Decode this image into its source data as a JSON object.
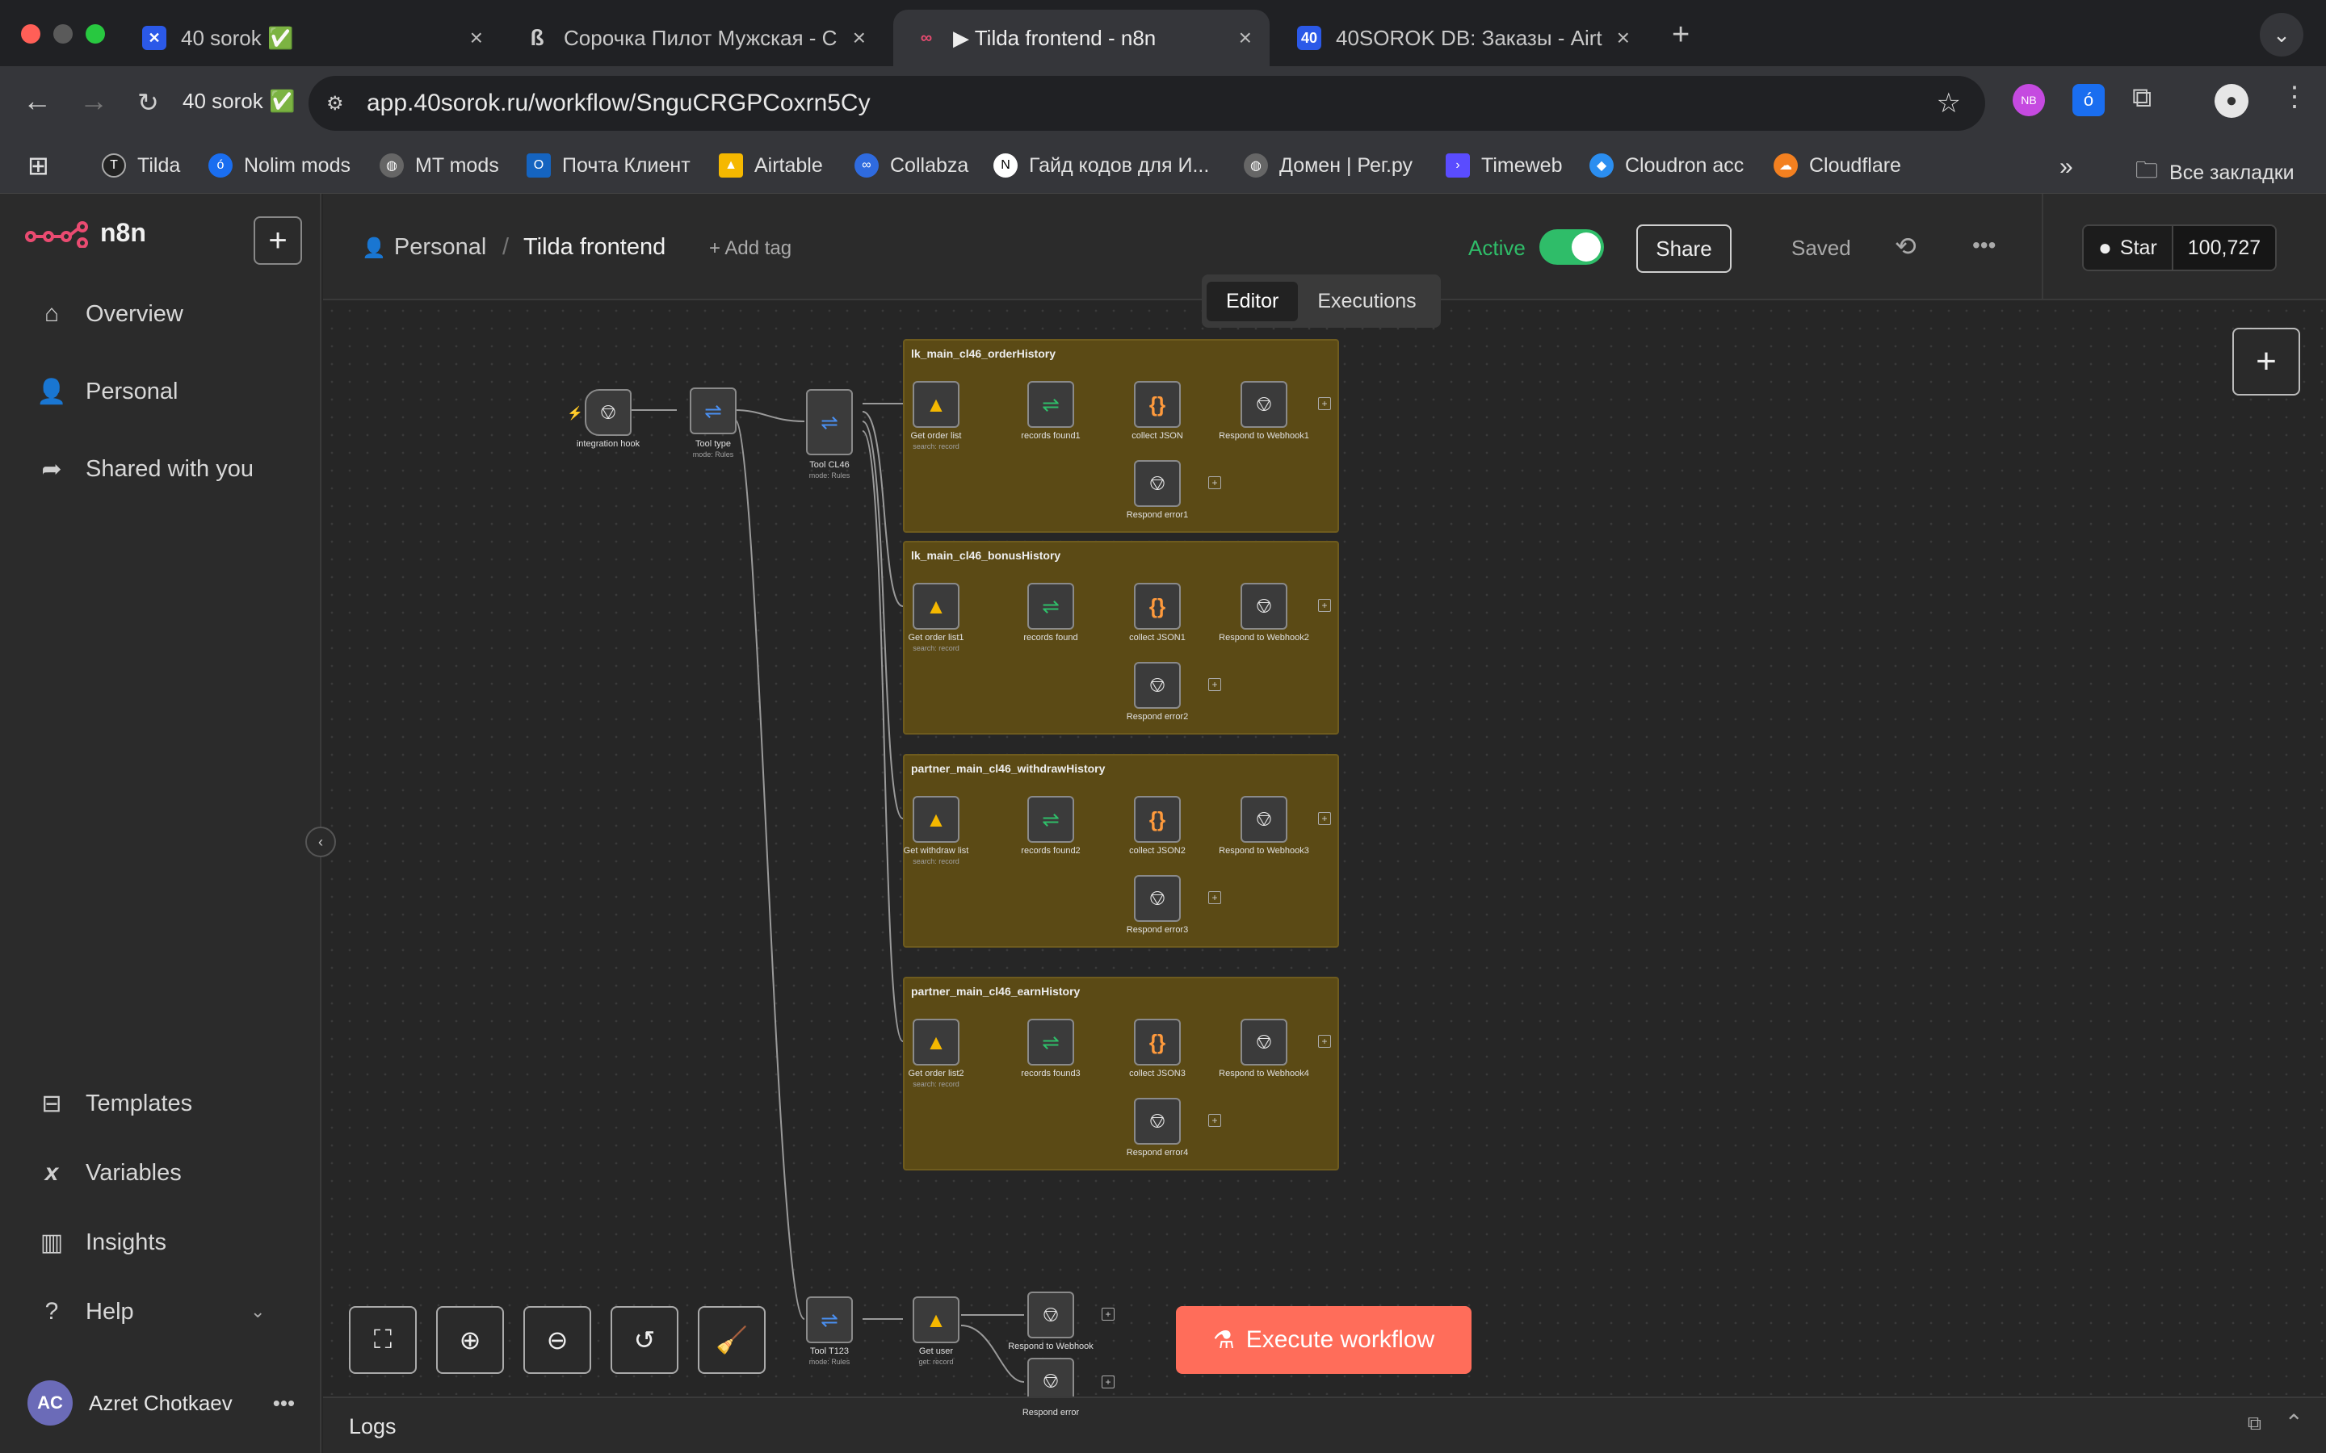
{
  "browser": {
    "tabs": [
      {
        "title": "40 sorok ✅",
        "fav_color": "#2b59e8"
      },
      {
        "title": "Сорочка Пилот Мужская - С",
        "fav_color": "#444444"
      },
      {
        "title": "▶ Tilda frontend - n8n",
        "fav_color": "#ea4b71"
      },
      {
        "title": "40SOROK DB: Заказы - Airta",
        "fav_color": "#2b59e8"
      }
    ],
    "tab_info": "40 sorok ✅",
    "url": "app.40sorok.ru/workflow/SnguCRGPCoxrn5Cy",
    "bookmarks": [
      {
        "label": "Tilda",
        "color": "#333333"
      },
      {
        "label": "Nolim mods",
        "color": "#1a6ef0"
      },
      {
        "label": "MT mods",
        "color": "#666666"
      },
      {
        "label": "Почта Клиент",
        "color": "#1564c0"
      },
      {
        "label": "Airtable",
        "color": "#f5b800"
      },
      {
        "label": "Collabza",
        "color": "#2f6bdf"
      },
      {
        "label": "Гайд кодов для И...",
        "color": "#ffffff"
      },
      {
        "label": "Домен | Рег.ру",
        "color": "#666666"
      },
      {
        "label": "Timeweb",
        "color": "#5a4cff"
      },
      {
        "label": "Cloudron acc",
        "color": "#2b8ef0"
      },
      {
        "label": "Cloudflare",
        "color": "#f38020"
      }
    ],
    "all_bookmarks": "Все закладки"
  },
  "sidebar": {
    "brand": "n8n",
    "nav": [
      "Overview",
      "Personal",
      "Shared with you"
    ],
    "bottom": [
      "Templates",
      "Variables",
      "Insights",
      "Help"
    ],
    "user_initials": "AC",
    "user_name": "Azret Chotkaev"
  },
  "header": {
    "project": "Personal",
    "workflow_name": "Tilda frontend",
    "add_tag": "+ Add tag",
    "active_label": "Active",
    "share": "Share",
    "saved": "Saved",
    "star": "Star",
    "stars_count": "100,727",
    "tabs": [
      "Editor",
      "Executions"
    ]
  },
  "canvas": {
    "nodes_main": [
      {
        "label": "integration hook",
        "sub": ""
      },
      {
        "label": "Tool type",
        "sub": "mode: Rules"
      },
      {
        "label": "Tool CL46",
        "sub": "mode: Rules"
      }
    ],
    "groups": [
      {
        "title": "lk_main_cl46_orderHistory",
        "n1": "Get order list",
        "n2": "records found1",
        "n3": "collect JSON",
        "n4": "Respond to Webhook1",
        "err": "Respond error1"
      },
      {
        "title": "lk_main_cl46_bonusHistory",
        "n1": "Get order list1",
        "n2": "records found",
        "n3": "collect JSON1",
        "n4": "Respond to Webhook2",
        "err": "Respond error2"
      },
      {
        "title": "partner_main_cl46_withdrawHistory",
        "n1": "Get withdraw list",
        "n2": "records found2",
        "n3": "collect JSON2",
        "n4": "Respond to Webhook3",
        "err": "Respond error3"
      },
      {
        "title": "partner_main_cl46_earnHistory",
        "n1": "Get order list2",
        "n2": "records found3",
        "n3": "collect JSON3",
        "n4": "Respond to Webhook4",
        "err": "Respond error4"
      }
    ],
    "search_sub": "search: record",
    "bottom_nodes": [
      {
        "label": "Tool T123",
        "sub": "mode: Rules"
      },
      {
        "label": "Get user",
        "sub": "get: record"
      },
      {
        "label": "Respond to Webhook",
        "sub": ""
      },
      {
        "label": "Respond error",
        "sub": ""
      }
    ],
    "execute": "Execute workflow"
  },
  "logs": "Logs",
  "colors": {
    "accent": "#ff6d5a",
    "active": "#2fbd69",
    "group": "#5b4a15"
  }
}
